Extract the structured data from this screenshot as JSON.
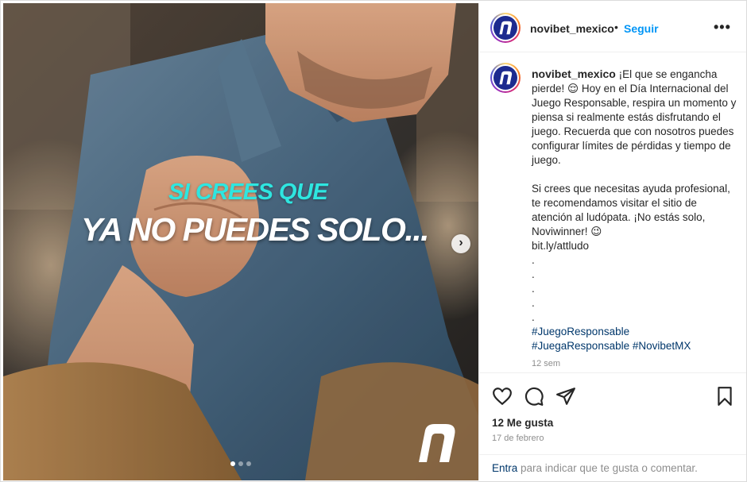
{
  "post": {
    "overlay": {
      "line1": "SI CREES QUE",
      "line2": "YA NO PUEDES SOLO..."
    },
    "carousel": {
      "slides": 3,
      "active": 1
    }
  },
  "header": {
    "username": "novibet_mexico",
    "separator": "•",
    "follow_label": "Seguir",
    "more_label": "•••"
  },
  "caption": {
    "username": "novibet_mexico",
    "para1": "¡El que se engancha pierde! 😌 Hoy en el Día Internacional del Juego Responsable, respira un momento y piensa si realmente estás disfrutando el juego. Recuerda que con nosotros puedes configurar límites de pérdidas y tiempo de juego.",
    "para2": "Si crees que necesitas ayuda profesional, te recomendamos visitar el sitio de atención al ludópata. ¡No estás solo, Noviwinner! 😉",
    "link": "bit.ly/attludo",
    "dots": [
      ".",
      ".",
      ".",
      ".",
      "."
    ],
    "hashtags": [
      "#JuegoResponsable",
      "#JuegaResponsable",
      "#NovibetMX"
    ],
    "time_ago": "12 sem"
  },
  "actions": {
    "icons": [
      "heart-icon",
      "comment-icon",
      "share-icon",
      "bookmark-icon"
    ]
  },
  "likes_label": "12 Me gusta",
  "date": "17 de febrero",
  "footer": {
    "login_link": "Entra",
    "rest": " para indicar que te gusta o comentar."
  },
  "colors": {
    "accent": "#0095f6",
    "overlay_cyan": "#2ee6e0",
    "brand_navy": "#1d2b8f",
    "hashtag": "#00376b"
  }
}
